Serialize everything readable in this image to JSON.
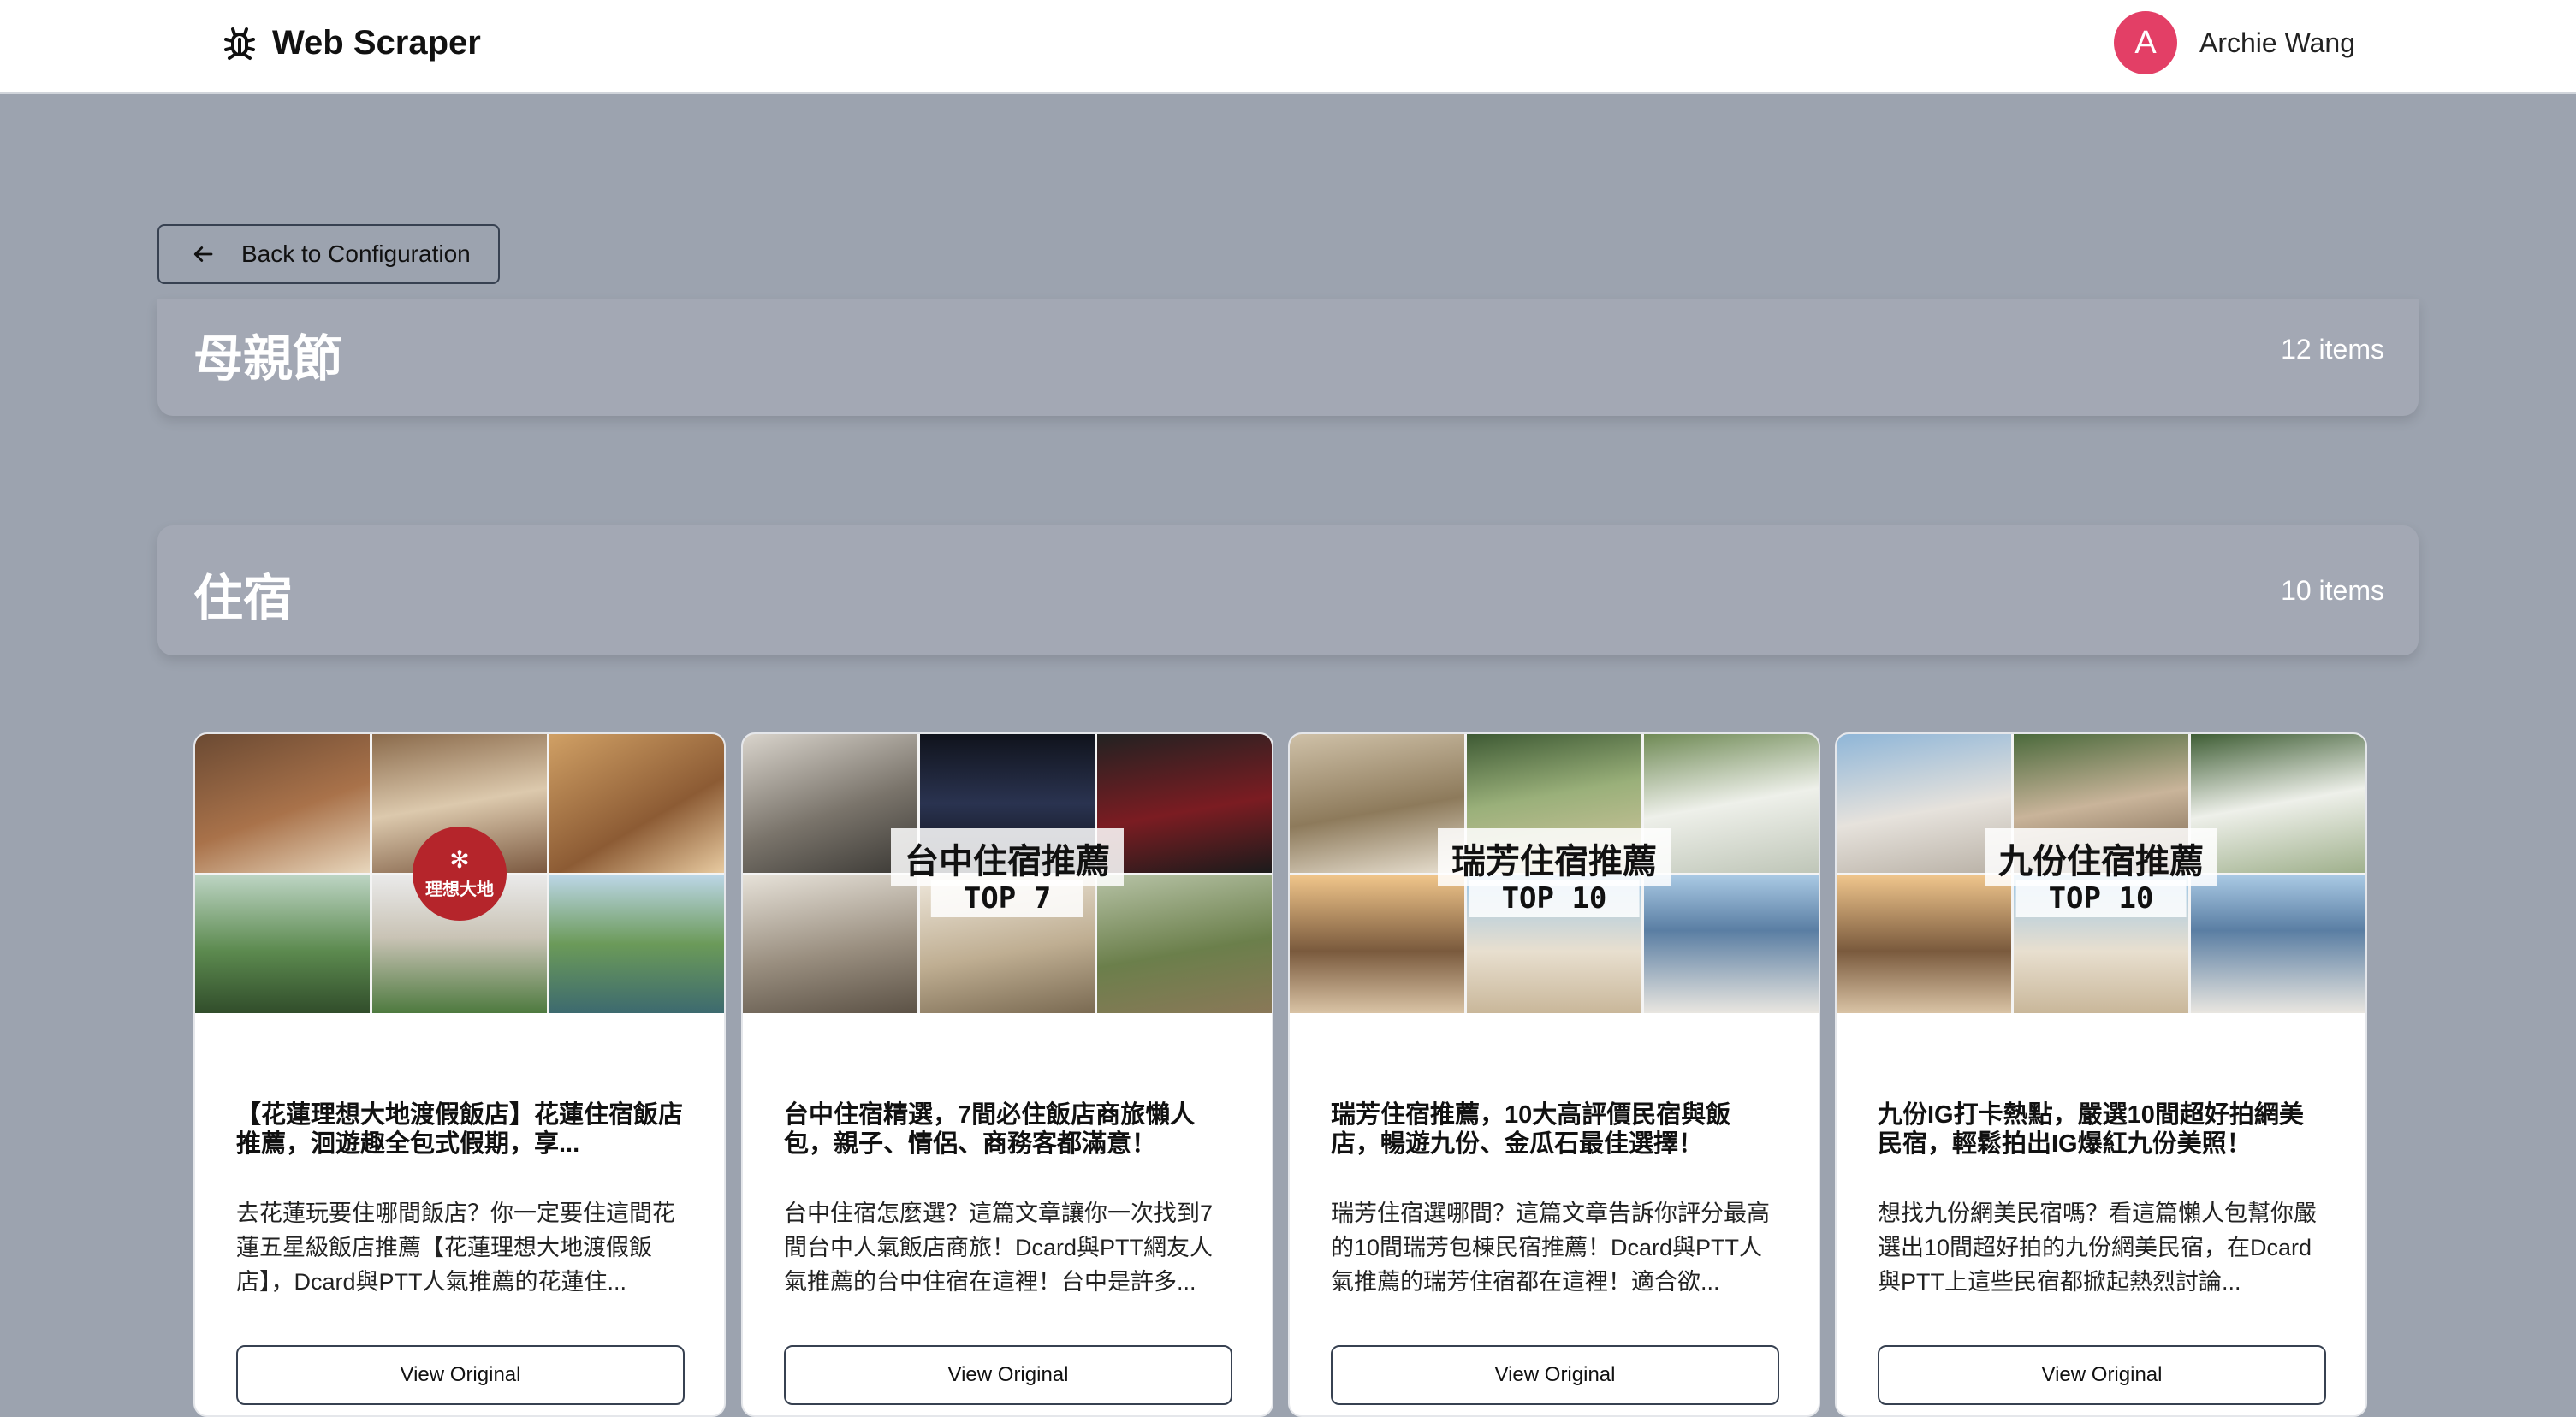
{
  "app": {
    "title": "Web Scraper",
    "icon": "bug-icon"
  },
  "user": {
    "initial": "A",
    "name": "Archie Wang",
    "avatar_color": "#e33f66"
  },
  "back_button": {
    "label": "Back to Configuration",
    "icon": "arrow-left-icon"
  },
  "groups": [
    {
      "title": "母親節",
      "count": "12 items"
    },
    {
      "title": "住宿",
      "count": "10 items"
    }
  ],
  "cards": [
    {
      "image_logo_name": "理想大地",
      "title": "【花蓮理想大地渡假飯店】花蓮住宿飯店推薦，洄遊趣全包式假期，享...",
      "description": "去花蓮玩要住哪間飯店？你一定要住這間花蓮五星級飯店推薦【花蓮理想大地渡假飯店】，Dcard與PTT人氣推薦的花蓮住...",
      "button": "View Original"
    },
    {
      "image_title": "台中住宿推薦",
      "image_sub": "TOP 7",
      "title": "台中住宿精選，7間必住飯店商旅懶人包，親子、情侶、商務客都滿意！",
      "description": "台中住宿怎麼選？這篇文章讓你一次找到7間台中人氣飯店商旅！Dcard與PTT網友人氣推薦的台中住宿在這裡！台中是許多...",
      "button": "View Original"
    },
    {
      "image_title": "瑞芳住宿推薦",
      "image_sub": "TOP 10",
      "title": "瑞芳住宿推薦，10大高評價民宿與飯店，暢遊九份、金瓜石最佳選擇！",
      "description": "瑞芳住宿選哪間？這篇文章告訴你評分最高的10間瑞芳包棟民宿推薦！Dcard與PTT人氣推薦的瑞芳住宿都在這裡！適合欲...",
      "button": "View Original"
    },
    {
      "image_title": "九份住宿推薦",
      "image_sub": "TOP 10",
      "title": "九份IG打卡熱點，嚴選10間超好拍網美民宿，輕鬆拍出IG爆紅九份美照！",
      "description": "想找九份網美民宿嗎？看這篇懶人包幫你嚴選出10間超好拍的九份網美民宿，在Dcard與PTT上這些民宿都掀起熱烈討論...",
      "button": "View Original"
    }
  ]
}
